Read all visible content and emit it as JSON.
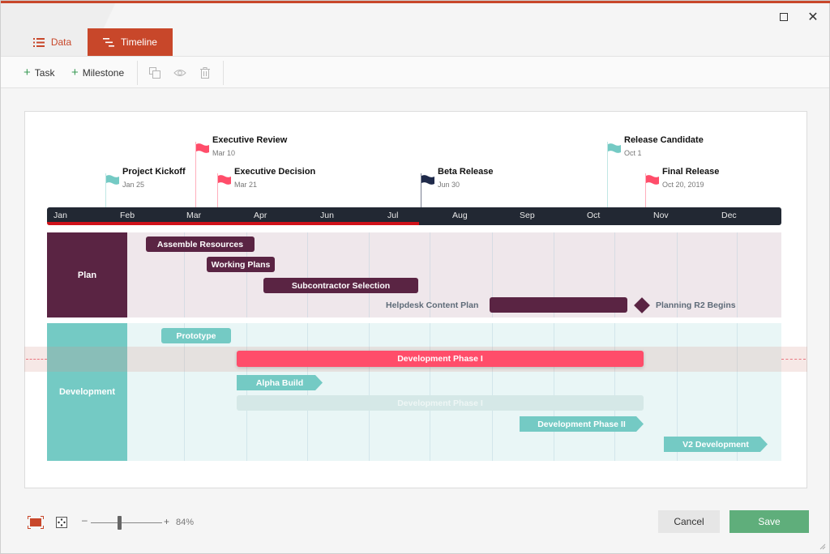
{
  "window": {
    "maximize_icon": "maximize-icon",
    "close_icon": "close-icon",
    "accent_color": "#c8472a"
  },
  "tabs": [
    {
      "label": "Data",
      "icon": "list-icon",
      "active": false
    },
    {
      "label": "Timeline",
      "icon": "timeline-icon",
      "active": true
    }
  ],
  "toolbar": {
    "add_task_label": "Task",
    "add_milestone_label": "Milestone",
    "icons": [
      "duplicate-icon",
      "visibility-icon",
      "delete-icon"
    ]
  },
  "timeline": {
    "months": [
      "Jan",
      "Feb",
      "Mar",
      "Apr",
      "Jun",
      "Jul",
      "Aug",
      "Sep",
      "Oct",
      "Nov",
      "Dec"
    ],
    "progress_through": "Jul",
    "progress_color": "#d0121a",
    "scale_color": "#222833"
  },
  "milestones": [
    {
      "title": "Project Kickoff",
      "date": "Jan 25",
      "color": "#74cac4"
    },
    {
      "title": "Executive Review",
      "date": "Mar 10",
      "color": "#ff4d6a"
    },
    {
      "title": "Executive Decision",
      "date": "Mar 21",
      "color": "#ff4d6a"
    },
    {
      "title": "Beta Release",
      "date": "Jun 30",
      "color": "#1f2a4a"
    },
    {
      "title": "Release Candidate",
      "date": "Oct 1",
      "color": "#74cac4"
    },
    {
      "title": "Final Release",
      "date": "Oct 20, 2019",
      "color": "#ff4d6a"
    }
  ],
  "swimlanes": [
    {
      "name": "Plan",
      "color": "#5a2443",
      "tasks": [
        {
          "label": "Assemble Resources"
        },
        {
          "label": "Working Plans"
        },
        {
          "label": "Subcontractor Selection"
        },
        {
          "label": "Helpdesk Content Plan"
        }
      ],
      "milestone": {
        "label": "Planning R2 Begins"
      }
    },
    {
      "name": "Development",
      "color": "#74cac4",
      "tasks": [
        {
          "label": "Prototype"
        },
        {
          "label": "Development Phase I",
          "highlighted": true,
          "color": "#ff4d6a"
        },
        {
          "label": "Alpha Build"
        },
        {
          "label": "Development Phase I",
          "ghost": true
        },
        {
          "label": "Development Phase II"
        },
        {
          "label": "V2 Development"
        }
      ]
    }
  ],
  "footer": {
    "fit_icon": "fit-to-screen-icon",
    "center_icon": "center-view-icon",
    "zoom_minus": "–",
    "zoom_plus": "+",
    "zoom_value": "84%",
    "zoom_level_percent": 84,
    "cancel_label": "Cancel",
    "save_label": "Save"
  }
}
